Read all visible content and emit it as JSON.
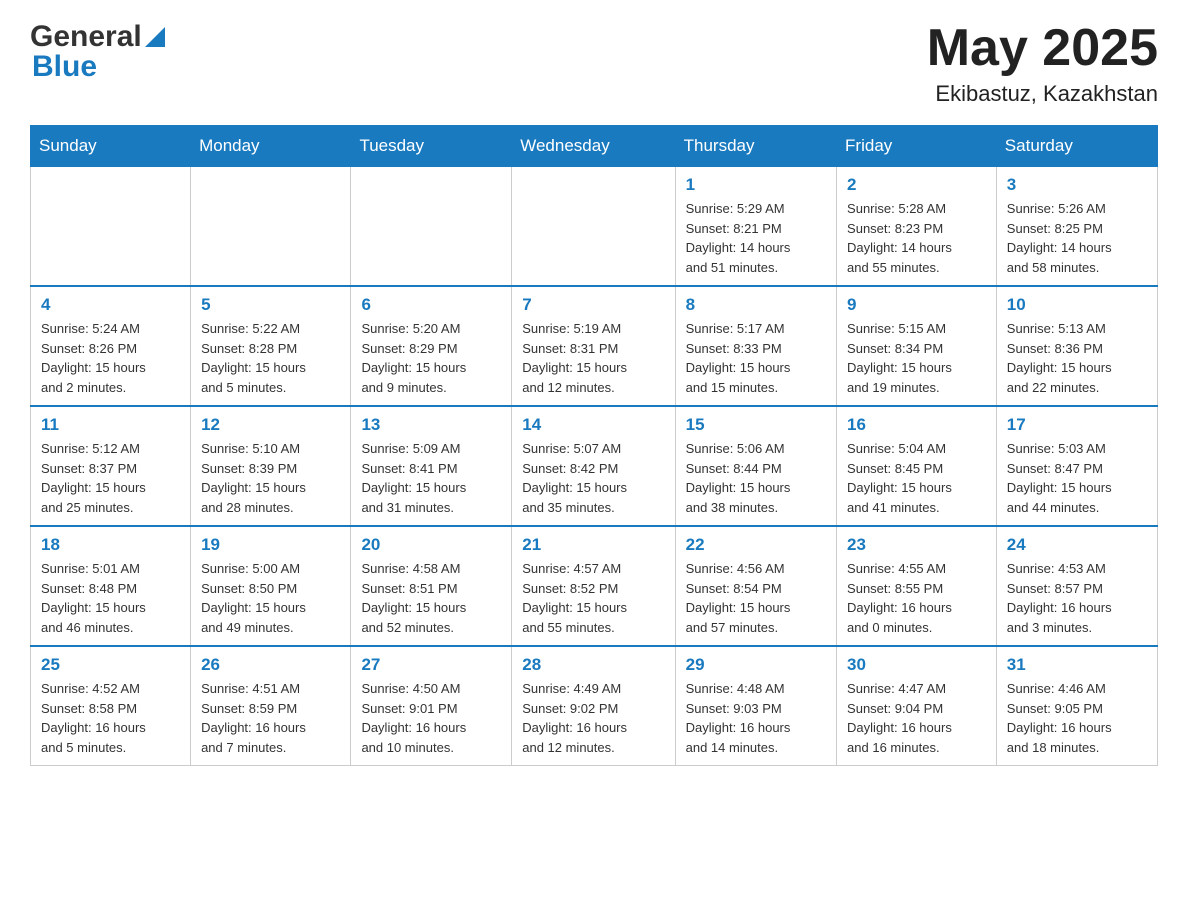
{
  "header": {
    "logo_general": "General",
    "logo_blue": "Blue",
    "month_title": "May 2025",
    "location": "Ekibastuz, Kazakhstan"
  },
  "days_of_week": [
    "Sunday",
    "Monday",
    "Tuesday",
    "Wednesday",
    "Thursday",
    "Friday",
    "Saturday"
  ],
  "weeks": [
    {
      "days": [
        {
          "num": "",
          "info": ""
        },
        {
          "num": "",
          "info": ""
        },
        {
          "num": "",
          "info": ""
        },
        {
          "num": "",
          "info": ""
        },
        {
          "num": "1",
          "info": "Sunrise: 5:29 AM\nSunset: 8:21 PM\nDaylight: 14 hours\nand 51 minutes."
        },
        {
          "num": "2",
          "info": "Sunrise: 5:28 AM\nSunset: 8:23 PM\nDaylight: 14 hours\nand 55 minutes."
        },
        {
          "num": "3",
          "info": "Sunrise: 5:26 AM\nSunset: 8:25 PM\nDaylight: 14 hours\nand 58 minutes."
        }
      ]
    },
    {
      "days": [
        {
          "num": "4",
          "info": "Sunrise: 5:24 AM\nSunset: 8:26 PM\nDaylight: 15 hours\nand 2 minutes."
        },
        {
          "num": "5",
          "info": "Sunrise: 5:22 AM\nSunset: 8:28 PM\nDaylight: 15 hours\nand 5 minutes."
        },
        {
          "num": "6",
          "info": "Sunrise: 5:20 AM\nSunset: 8:29 PM\nDaylight: 15 hours\nand 9 minutes."
        },
        {
          "num": "7",
          "info": "Sunrise: 5:19 AM\nSunset: 8:31 PM\nDaylight: 15 hours\nand 12 minutes."
        },
        {
          "num": "8",
          "info": "Sunrise: 5:17 AM\nSunset: 8:33 PM\nDaylight: 15 hours\nand 15 minutes."
        },
        {
          "num": "9",
          "info": "Sunrise: 5:15 AM\nSunset: 8:34 PM\nDaylight: 15 hours\nand 19 minutes."
        },
        {
          "num": "10",
          "info": "Sunrise: 5:13 AM\nSunset: 8:36 PM\nDaylight: 15 hours\nand 22 minutes."
        }
      ]
    },
    {
      "days": [
        {
          "num": "11",
          "info": "Sunrise: 5:12 AM\nSunset: 8:37 PM\nDaylight: 15 hours\nand 25 minutes."
        },
        {
          "num": "12",
          "info": "Sunrise: 5:10 AM\nSunset: 8:39 PM\nDaylight: 15 hours\nand 28 minutes."
        },
        {
          "num": "13",
          "info": "Sunrise: 5:09 AM\nSunset: 8:41 PM\nDaylight: 15 hours\nand 31 minutes."
        },
        {
          "num": "14",
          "info": "Sunrise: 5:07 AM\nSunset: 8:42 PM\nDaylight: 15 hours\nand 35 minutes."
        },
        {
          "num": "15",
          "info": "Sunrise: 5:06 AM\nSunset: 8:44 PM\nDaylight: 15 hours\nand 38 minutes."
        },
        {
          "num": "16",
          "info": "Sunrise: 5:04 AM\nSunset: 8:45 PM\nDaylight: 15 hours\nand 41 minutes."
        },
        {
          "num": "17",
          "info": "Sunrise: 5:03 AM\nSunset: 8:47 PM\nDaylight: 15 hours\nand 44 minutes."
        }
      ]
    },
    {
      "days": [
        {
          "num": "18",
          "info": "Sunrise: 5:01 AM\nSunset: 8:48 PM\nDaylight: 15 hours\nand 46 minutes."
        },
        {
          "num": "19",
          "info": "Sunrise: 5:00 AM\nSunset: 8:50 PM\nDaylight: 15 hours\nand 49 minutes."
        },
        {
          "num": "20",
          "info": "Sunrise: 4:58 AM\nSunset: 8:51 PM\nDaylight: 15 hours\nand 52 minutes."
        },
        {
          "num": "21",
          "info": "Sunrise: 4:57 AM\nSunset: 8:52 PM\nDaylight: 15 hours\nand 55 minutes."
        },
        {
          "num": "22",
          "info": "Sunrise: 4:56 AM\nSunset: 8:54 PM\nDaylight: 15 hours\nand 57 minutes."
        },
        {
          "num": "23",
          "info": "Sunrise: 4:55 AM\nSunset: 8:55 PM\nDaylight: 16 hours\nand 0 minutes."
        },
        {
          "num": "24",
          "info": "Sunrise: 4:53 AM\nSunset: 8:57 PM\nDaylight: 16 hours\nand 3 minutes."
        }
      ]
    },
    {
      "days": [
        {
          "num": "25",
          "info": "Sunrise: 4:52 AM\nSunset: 8:58 PM\nDaylight: 16 hours\nand 5 minutes."
        },
        {
          "num": "26",
          "info": "Sunrise: 4:51 AM\nSunset: 8:59 PM\nDaylight: 16 hours\nand 7 minutes."
        },
        {
          "num": "27",
          "info": "Sunrise: 4:50 AM\nSunset: 9:01 PM\nDaylight: 16 hours\nand 10 minutes."
        },
        {
          "num": "28",
          "info": "Sunrise: 4:49 AM\nSunset: 9:02 PM\nDaylight: 16 hours\nand 12 minutes."
        },
        {
          "num": "29",
          "info": "Sunrise: 4:48 AM\nSunset: 9:03 PM\nDaylight: 16 hours\nand 14 minutes."
        },
        {
          "num": "30",
          "info": "Sunrise: 4:47 AM\nSunset: 9:04 PM\nDaylight: 16 hours\nand 16 minutes."
        },
        {
          "num": "31",
          "info": "Sunrise: 4:46 AM\nSunset: 9:05 PM\nDaylight: 16 hours\nand 18 minutes."
        }
      ]
    }
  ]
}
